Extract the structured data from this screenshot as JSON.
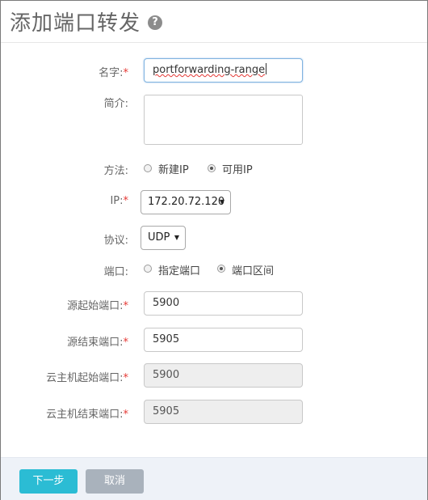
{
  "dialog": {
    "title": "添加端口转发",
    "help_icon": "question-circle-icon"
  },
  "form": {
    "name": {
      "label": "名字:",
      "required_mark": "*",
      "value": "portforwarding-range"
    },
    "description": {
      "label": "简介:",
      "value": ""
    },
    "method": {
      "label": "方法:",
      "options": [
        {
          "label": "新建IP",
          "checked": false
        },
        {
          "label": "可用IP",
          "checked": true
        }
      ]
    },
    "ip": {
      "label": "IP:",
      "required_mark": "*",
      "selected": "172.20.72.120"
    },
    "protocol": {
      "label": "协议:",
      "selected": "UDP"
    },
    "port": {
      "label": "端口:",
      "options": [
        {
          "label": "指定端口",
          "checked": false
        },
        {
          "label": "端口区间",
          "checked": true
        }
      ]
    },
    "source_start_port": {
      "label": "源起始端口:",
      "required_mark": "*",
      "value": "5900"
    },
    "source_end_port": {
      "label": "源结束端口:",
      "required_mark": "*",
      "value": "5905"
    },
    "vm_start_port": {
      "label": "云主机起始端口:",
      "required_mark": "*",
      "value": "5900"
    },
    "vm_end_port": {
      "label": "云主机结束端口:",
      "required_mark": "*",
      "value": "5905"
    }
  },
  "footer": {
    "next_label": "下一步",
    "cancel_label": "取消"
  },
  "colors": {
    "primary_button": "#2bbcd4",
    "cancel_button": "#a9b2bc",
    "required": "#e53935",
    "footer_bg": "#eef2f8"
  }
}
